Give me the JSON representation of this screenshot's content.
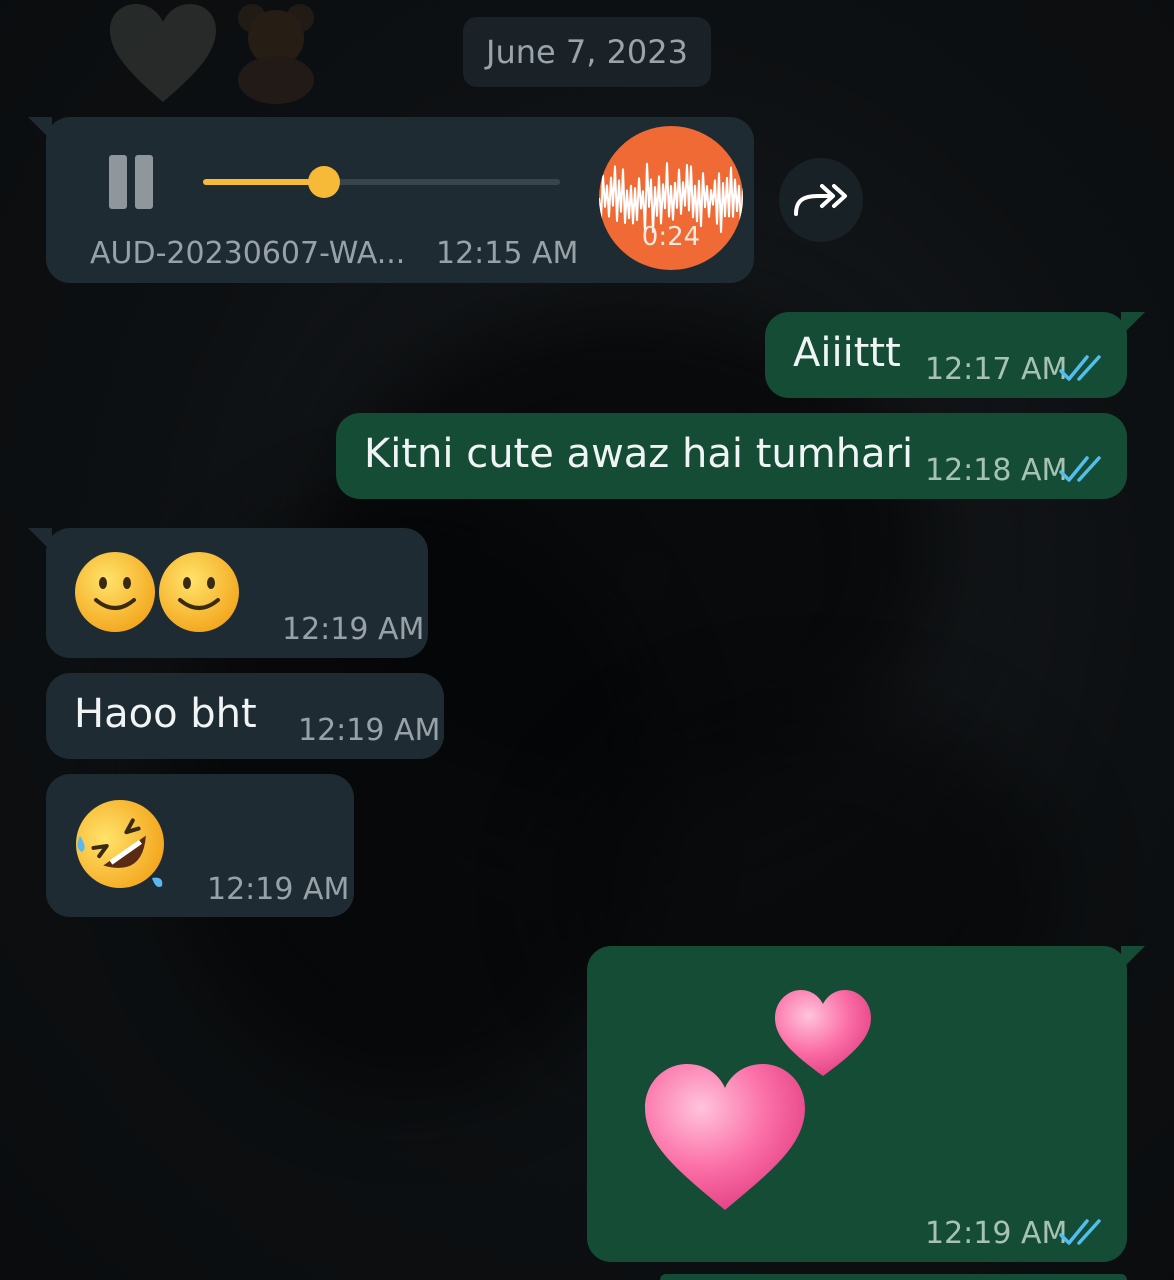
{
  "date_separator": "June 7, 2023",
  "messages": [
    {
      "type": "audio",
      "direction": "incoming",
      "file_name": "AUD-20230607-WA...",
      "duration": "0:24",
      "time": "12:15 AM",
      "progress": 0.34,
      "art_color": "#f06a35"
    },
    {
      "type": "text",
      "direction": "outgoing",
      "text": "Aiiittt",
      "time": "12:17 AM",
      "status": "read"
    },
    {
      "type": "text",
      "direction": "outgoing",
      "text": "Kitni cute awaz hai tumhari",
      "time": "12:18 AM",
      "status": "read"
    },
    {
      "type": "emoji",
      "direction": "incoming",
      "emoji": "slightly-smiling-face x2",
      "time": "12:19 AM"
    },
    {
      "type": "text",
      "direction": "incoming",
      "text": "Haoo bht",
      "time": "12:19 AM"
    },
    {
      "type": "emoji",
      "direction": "incoming",
      "emoji": "rolling-on-floor-laughing",
      "time": "12:19 AM"
    },
    {
      "type": "emoji",
      "direction": "outgoing",
      "emoji": "two-hearts",
      "time": "12:19 AM",
      "status": "read"
    }
  ],
  "colors": {
    "incoming_bubble": "#1f2b32",
    "outgoing_bubble": "#154c36",
    "read_ticks": "#53bdeb",
    "audio_progress": "#f7b938"
  },
  "icons": {
    "pause": "pause-icon",
    "forward": "forward-icon",
    "read_receipt": "double-check-icon"
  }
}
